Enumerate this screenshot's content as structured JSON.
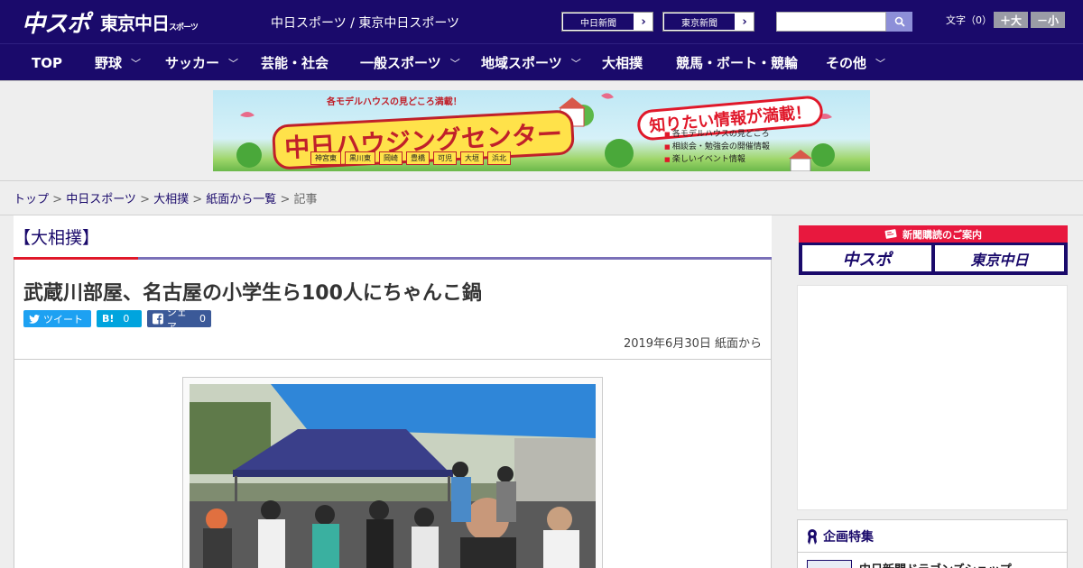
{
  "header": {
    "logo_main": "中スポ",
    "logo_sub": "東京中日",
    "logo_sub_small": "スポーツ",
    "site_title": "中日スポーツ / 東京中日スポーツ",
    "links": [
      {
        "label": "中日新聞",
        "arrow": "›"
      },
      {
        "label": "東京新聞",
        "arrow": "›"
      }
    ],
    "search": {
      "value": "",
      "placeholder": ""
    },
    "textsize_label": "文字（0）",
    "size_up": "＋大",
    "size_down": "－小"
  },
  "nav": {
    "items": [
      {
        "label": "TOP",
        "has_dropdown": false
      },
      {
        "label": "野球",
        "has_dropdown": true
      },
      {
        "label": "サッカー",
        "has_dropdown": true
      },
      {
        "label": "芸能・社会",
        "has_dropdown": false
      },
      {
        "label": "一般スポーツ",
        "has_dropdown": true
      },
      {
        "label": "地域スポーツ",
        "has_dropdown": true
      },
      {
        "label": "大相撲",
        "has_dropdown": false
      },
      {
        "label": "競馬・ボート・競輪",
        "has_dropdown": false
      },
      {
        "label": "その他",
        "has_dropdown": true
      }
    ],
    "chevron": "﹀"
  },
  "banner": {
    "top_text": "各モデルハウスの見どころ満載！",
    "title": "中日ハウジングセンター",
    "catch": "知りたい情報が満載！",
    "list": [
      "各モデルハウスの見どころ",
      "相談会・勉強会の開催情報",
      "楽しいイベント情報"
    ],
    "cities": [
      "神宮東",
      "黒川東",
      "岡崎",
      "豊橋",
      "可児",
      "大垣",
      "浜北"
    ]
  },
  "breadcrumb": {
    "items": [
      "トップ",
      "中日スポーツ",
      "大相撲",
      "紙面から一覧"
    ],
    "current": "記事",
    "separator": " > "
  },
  "article": {
    "category": "【大相撲】",
    "headline": "武蔵川部屋、名古屋の小学生ら100人にちゃんこ鍋",
    "share": {
      "tweet_label": "ツイート",
      "hatena_label": "B!",
      "hatena_count": "0",
      "facebook_label": "シェア",
      "facebook_count": "0"
    },
    "date": "2019年6月30日 紙面から"
  },
  "sidebar": {
    "subscription_header": "新聞購読のご案内",
    "subscription_buttons": [
      "中スポ",
      "東京中日"
    ],
    "feature_title": "企画特集",
    "feature_item": "中日新聞ドラゴンズショップ"
  },
  "colors": {
    "brand": "#1a0a6b",
    "accent_red": "#e0182a"
  }
}
